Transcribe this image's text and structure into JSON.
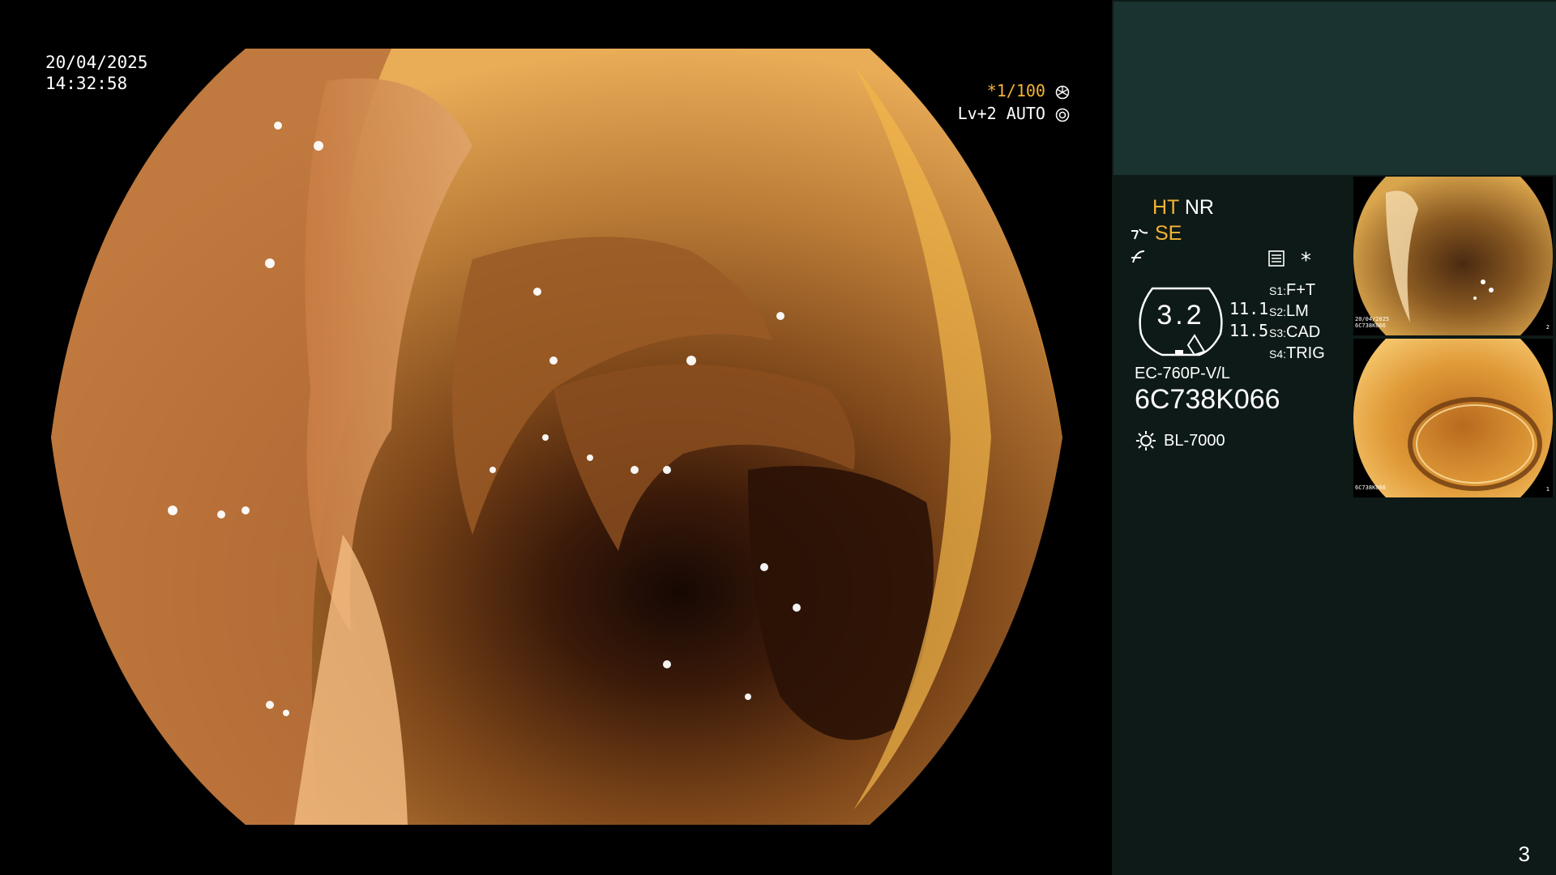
{
  "overlay": {
    "date": "20/04/2025",
    "time": "14:32:58",
    "shutter": "*1/100",
    "level": "Lv+2",
    "mode": "AUTO"
  },
  "sidebar": {
    "ht": "HT",
    "nr": "NR",
    "se": "SE",
    "gauge_value": "3.2",
    "gauge_nums": [
      "11.1",
      "11.5"
    ],
    "switches": [
      {
        "key": "S1:",
        "value": "F+T"
      },
      {
        "key": "S2:",
        "value": "LM"
      },
      {
        "key": "S3:",
        "value": "CAD"
      },
      {
        "key": "S4:",
        "value": "TRIG"
      }
    ],
    "scope_model": "EC-760P-V/L",
    "serial": "6C738K066",
    "light_source": "BL-7000",
    "thumbnails": [
      {
        "caption_date": "20/04/2025",
        "caption_serial": "6C738K066",
        "caption_light": "BL-7000",
        "index": "2"
      },
      {
        "caption_date": "",
        "caption_serial": "6C738K066",
        "caption_light": "BL-7000",
        "index": "1"
      }
    ]
  },
  "page_number": "3",
  "colors": {
    "accent": "#f5b335",
    "panel": "#0d1a17",
    "panel_top": "#1a3330"
  }
}
